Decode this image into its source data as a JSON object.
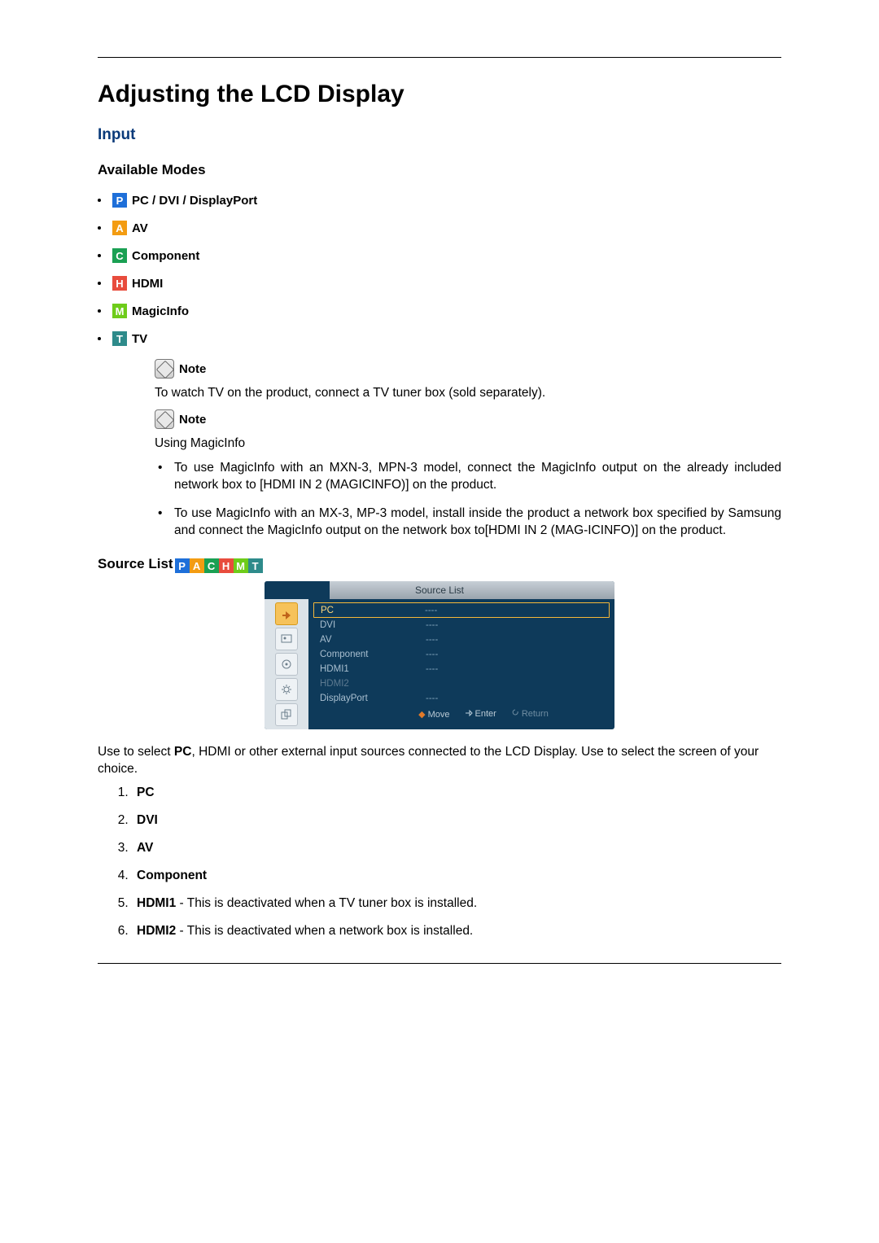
{
  "title": "Adjusting the LCD Display",
  "section_input": "Input",
  "available_modes_heading": "Available Modes",
  "modes": {
    "pc": {
      "glyph": "P",
      "label": "PC / DVI / DisplayPort"
    },
    "av": {
      "glyph": "A",
      "label": "AV"
    },
    "component": {
      "glyph": "C",
      "label": "Component"
    },
    "hdmi": {
      "glyph": "H",
      "label": "HDMI"
    },
    "magicinfo": {
      "glyph": "M",
      "label": "MagicInfo"
    },
    "tv": {
      "glyph": "T",
      "label": "TV"
    }
  },
  "note_label": "Note",
  "note1_text": "To watch TV on the product, connect a TV tuner box (sold separately).",
  "note2_intro": "Using MagicInfo",
  "note2_bullets": [
    "To use MagicInfo with an MXN-3, MPN-3 model, connect the MagicInfo output on the already included network box to [HDMI IN 2 (MAGICINFO)] on the product.",
    "To use MagicInfo with an MX-3, MP-3 model, install inside the product a network box specified by Samsung and connect the MagicInfo output on the network box to[HDMI IN 2 (MAG-ICINFO)] on the product."
  ],
  "source_list_heading": "Source List",
  "osd": {
    "title": "Source List",
    "rows": [
      {
        "label": "PC",
        "value": "----",
        "selected": true
      },
      {
        "label": "DVI",
        "value": "----",
        "selected": false
      },
      {
        "label": "AV",
        "value": "----",
        "selected": false
      },
      {
        "label": "Component",
        "value": "----",
        "selected": false
      },
      {
        "label": "HDMI1",
        "value": "----",
        "selected": false
      },
      {
        "label": "HDMI2",
        "value": "",
        "selected": false,
        "dim": true
      },
      {
        "label": "DisplayPort",
        "value": "----",
        "selected": false
      }
    ],
    "footer": {
      "move": "Move",
      "enter": "Enter",
      "ret": "Return"
    }
  },
  "source_list_desc_pre": "Use to select ",
  "source_list_desc_bold": "PC",
  "source_list_desc_post": ", HDMI or other external input sources connected to the LCD Display. Use to select the screen of your choice.",
  "sources": [
    {
      "name": "PC",
      "extra": ""
    },
    {
      "name": "DVI",
      "extra": ""
    },
    {
      "name": "AV",
      "extra": ""
    },
    {
      "name": "Component",
      "extra": ""
    },
    {
      "name": "HDMI1",
      "extra": " - This is deactivated when a TV tuner box is installed."
    },
    {
      "name": "HDMI2",
      "extra": " - This is deactivated when a network box is installed."
    }
  ]
}
